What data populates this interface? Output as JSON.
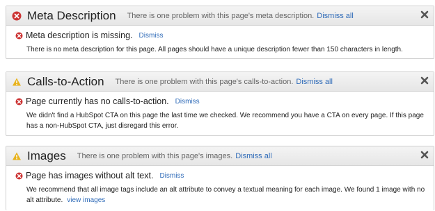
{
  "panels": [
    {
      "title": "Meta Description",
      "summary": "There is one problem with this page's meta description.",
      "dismiss_all": "Dismiss all",
      "issue_title": "Meta description is missing.",
      "dismiss": "Dismiss",
      "description": "There is no meta description for this page. All pages should have a unique description fewer than 150 characters in length."
    },
    {
      "title": "Calls-to-Action",
      "summary": "There is one problem with this page's calls-to-action.",
      "dismiss_all": "Dismiss all",
      "issue_title": "Page currently has no calls-to-action.",
      "dismiss": "Dismiss",
      "description": "We didn't find a HubSpot CTA on this page the last time we checked. We recommend you have a CTA on every page. If this page has a non-HubSpot CTA, just disregard this error."
    },
    {
      "title": "Images",
      "summary": "There is one problem with this page's images.",
      "dismiss_all": "Dismiss all",
      "issue_title": "Page has images without alt text.",
      "dismiss": "Dismiss",
      "description": "We recommend that all image tags include an alt attribute to convey a textual meaning for each image. We found 1 image with no alt attribute.",
      "link": "view images"
    }
  ],
  "colors": {
    "error": "#cc3333",
    "warning": "#e8b21a",
    "link": "#2f6bb8"
  }
}
